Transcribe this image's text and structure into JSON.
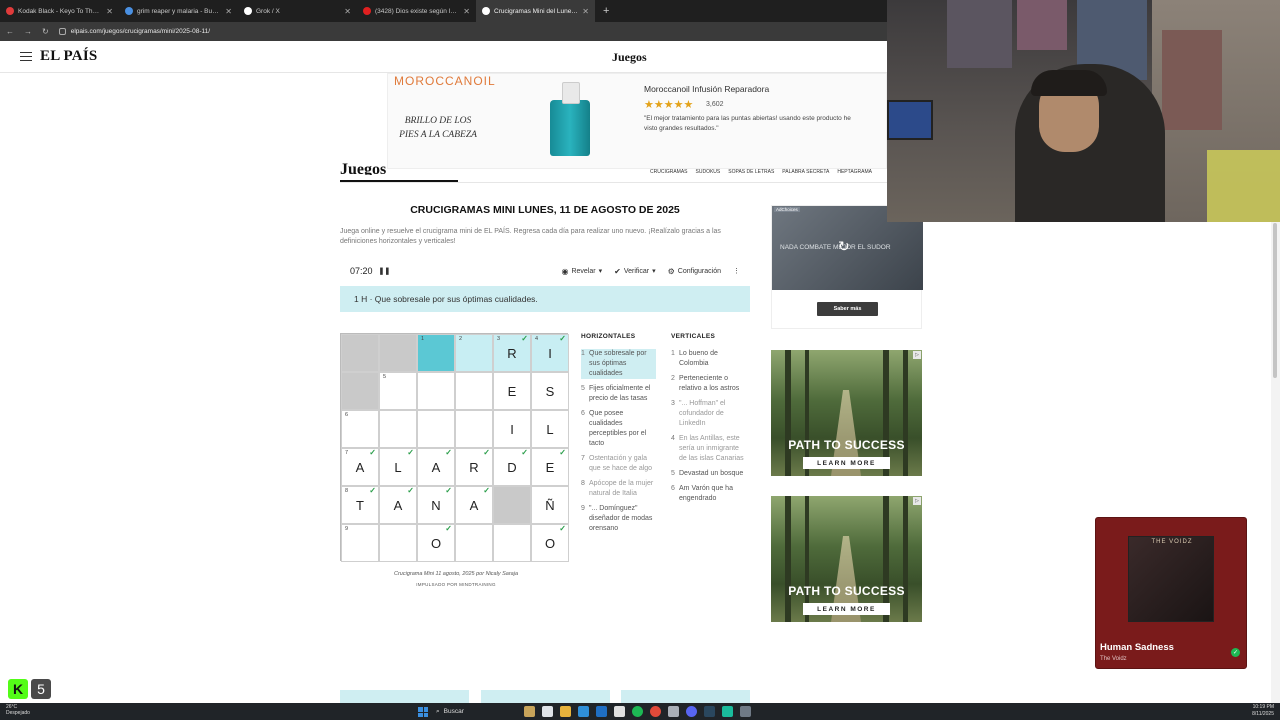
{
  "browser": {
    "tabs": [
      {
        "title": "Kodak Black - Keyo To The City",
        "color": "#e03b3b",
        "active": false
      },
      {
        "title": "grim reaper y malaria - Buscar",
        "color": "#4a90e2",
        "active": false
      },
      {
        "title": "Grok / X",
        "color": "#ffffff",
        "active": false
      },
      {
        "title": "(3428) Dios existe según la cie",
        "color": "#e02020",
        "active": false
      },
      {
        "title": "Crucigramas Mini del Lunes, 11",
        "color": "#ffffff",
        "active": true
      }
    ],
    "url": "elpais.com/juegos/crucigramas/mini/2025-08-11/"
  },
  "site": {
    "logo": "EL PAÍS",
    "section": "Juegos"
  },
  "top_ad": {
    "brand": "MOROCCANOIL",
    "tagline": "BRILLO DE LOS PIES A LA CABEZA",
    "product": "Moroccanoil Infusión Reparadora",
    "stars": "★★★★★",
    "reviews": "3,602",
    "quote": "\"El mejor tratamiento para las puntas abiertas! usando este producto he visto grandes resultados.\""
  },
  "games_nav": {
    "title": "Juegos",
    "links": [
      "CRUCIGRAMAS",
      "SUDOKUS",
      "SOPAS DE LETRAS",
      "PALABRA SECRETA",
      "HEPTAGRAMA"
    ]
  },
  "crossword": {
    "title": "CRUCIGRAMAS MINI LUNES, 11 DE AGOSTO DE 2025",
    "intro": "Juega online y resuelve el crucigrama mini de EL PAÍS. Regresa cada día para realizar uno nuevo. ¡Realízalo gracias a las definiciones horizontales y verticales!",
    "timer": "07:20",
    "pause": "❚❚",
    "toolbar": {
      "reveal": "Revelar",
      "verify": "Verificar",
      "settings": "Configuración",
      "more": "⋮"
    },
    "active_clue": "1 H · Que sobresale por sus óptimas cualidades.",
    "grid": [
      [
        {
          "t": "blk"
        },
        {
          "t": "blk"
        },
        {
          "t": "sel",
          "n": "1"
        },
        {
          "t": "hl",
          "n": "2"
        },
        {
          "t": "hl",
          "n": "3",
          "v": "R",
          "c": true
        },
        {
          "t": "hl",
          "n": "4",
          "v": "I",
          "c": true
        }
      ],
      [
        {
          "t": "blk"
        },
        {
          "n": "5"
        },
        {},
        {},
        {
          "v": "E"
        },
        {
          "v": "S"
        }
      ],
      [
        {
          "n": "6"
        },
        {},
        {},
        {},
        {
          "v": "I"
        },
        {
          "v": "L"
        }
      ],
      [
        {
          "n": "7",
          "v": "A",
          "c": true
        },
        {
          "v": "L",
          "c": true
        },
        {
          "v": "A",
          "c": true
        },
        {
          "v": "R",
          "c": true
        },
        {
          "v": "D",
          "c": true
        },
        {
          "v": "E",
          "c": true
        }
      ],
      [
        {
          "n": "8",
          "v": "T",
          "c": true
        },
        {
          "v": "A",
          "c": true
        },
        {
          "v": "N",
          "c": true
        },
        {
          "v": "A",
          "c": true
        },
        {
          "t": "blk"
        },
        {
          "v": "Ñ"
        }
      ],
      [
        {
          "n": "9"
        },
        {},
        {
          "v": "O",
          "c": true
        },
        {},
        {},
        {
          "v": "O",
          "c": true
        }
      ]
    ],
    "horizontales_title": "HORIZONTALES",
    "verticales_title": "VERTICALES",
    "horizontales": [
      {
        "n": "1",
        "text": "Que sobresale por sus óptimas cualidades",
        "state": "active"
      },
      {
        "n": "5",
        "text": "Fijes oficialmente el precio de las tasas",
        "state": ""
      },
      {
        "n": "6",
        "text": "Que posee cualidades perceptibles por el tacto",
        "state": ""
      },
      {
        "n": "7",
        "text": "Ostentación y gala que se hace de algo",
        "state": "done"
      },
      {
        "n": "8",
        "text": "Apócope de la mujer natural de Italia",
        "state": "done"
      },
      {
        "n": "9",
        "text": "\"... Domínguez\" diseñador de modas orensano",
        "state": ""
      }
    ],
    "verticales": [
      {
        "n": "1",
        "text": "Lo bueno de Colombia",
        "state": ""
      },
      {
        "n": "2",
        "text": "Perteneciente o relativo a los astros",
        "state": ""
      },
      {
        "n": "3",
        "text": "\"... Hoffman\" el cofundador de LinkedIn",
        "state": "done"
      },
      {
        "n": "4",
        "text": "En las Antillas, este sería un inmigrante de las islas Canarias",
        "state": "done"
      },
      {
        "n": "5",
        "text": "Devastad un bosque",
        "state": ""
      },
      {
        "n": "6",
        "text": "Am Varón que ha engendrado",
        "state": ""
      }
    ],
    "credit": "Crucigrama Mini 11 agosto, 2025 por Nicaly Saraja",
    "powered": "IMPULSADO POR MINDTRAINING"
  },
  "side_ads": {
    "choices": "AdChoices",
    "ad1_text": "NADA COMBATE MEJOR EL SUDOR",
    "ad1_button": "Saber más",
    "forest_title": "PATH TO SUCCESS",
    "forest_button": "LEARN MORE"
  },
  "spotify": {
    "album_text": "THE VOIDZ",
    "title": "Human Sadness",
    "artist": "The Voidz"
  },
  "kick": {
    "letter": "K",
    "count": "5"
  },
  "taskbar": {
    "weather_temp": "26°C",
    "weather_desc": "Despejado",
    "search": "Buscar",
    "time": "10:19 PM",
    "date": "8/11/2025"
  }
}
